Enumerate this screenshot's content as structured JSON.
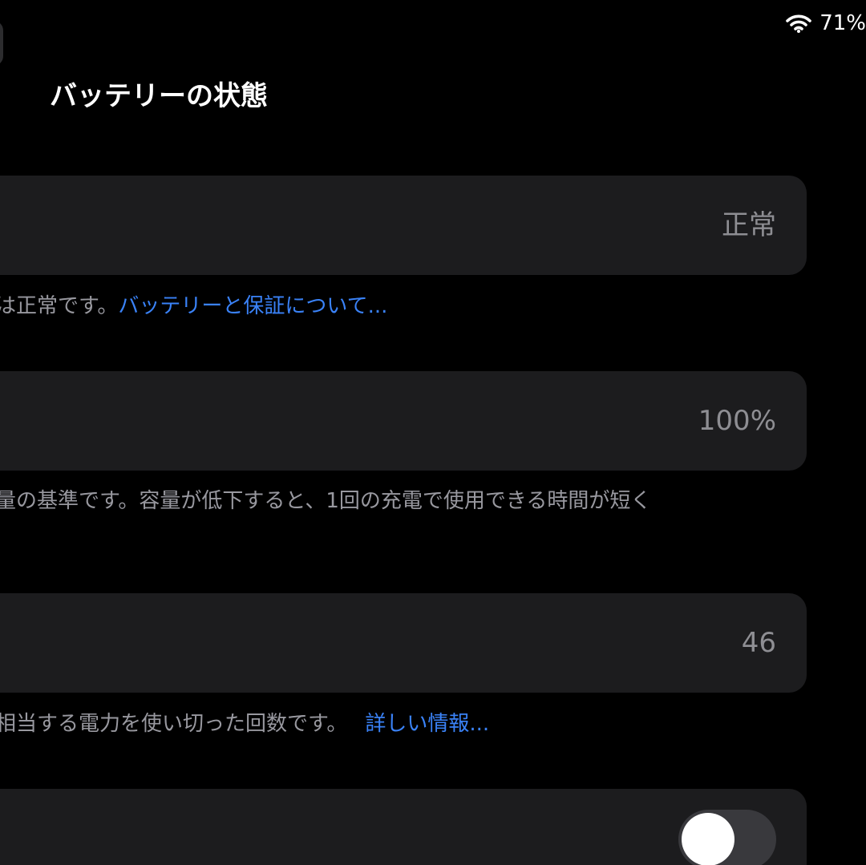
{
  "status_bar": {
    "battery_percent": "71%"
  },
  "header": {
    "title": "バッテリーの状態"
  },
  "sections": {
    "health": {
      "value": "正常",
      "footnote_text": "は正常です。",
      "footnote_link": "バッテリーと保証について..."
    },
    "capacity": {
      "value": "100%",
      "footnote_text": "量の基準です。容量が低下すると、1回の充電で使用できる時間が短く"
    },
    "cycle_count": {
      "value": "46",
      "footnote_text": "相当する電力を使い切った回数です。",
      "footnote_link": "詳しい情報..."
    },
    "toggle_row": {
      "on": false
    }
  },
  "colors": {
    "background": "#000000",
    "cell": "#1c1c1e",
    "link": "#3a82f7",
    "secondary_text": "#8e8e93"
  }
}
